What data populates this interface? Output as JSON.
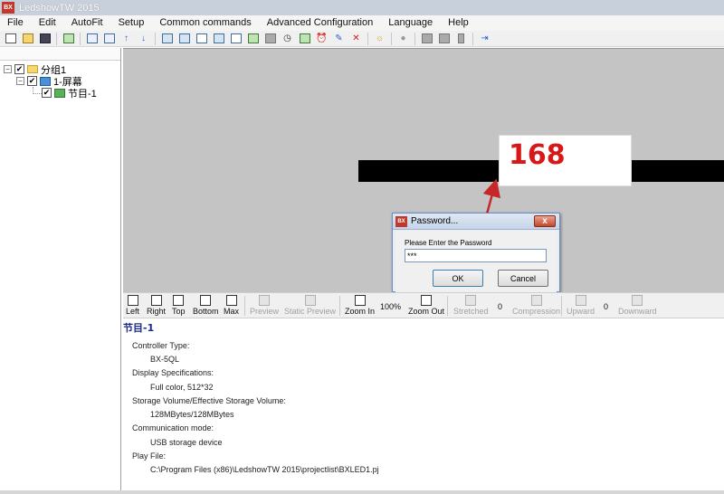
{
  "window": {
    "title": "LedshowTW 2015",
    "app_icon": "BX"
  },
  "menu": [
    "File",
    "Edit",
    "AutoFit",
    "Setup",
    "Common commands",
    "Advanced Configuration",
    "Language",
    "Help"
  ],
  "tree": {
    "group": "分组1",
    "screen": "1-屏幕",
    "program": "节目-1"
  },
  "callout": {
    "text": "168",
    "color": "#d81818"
  },
  "dialog": {
    "icon": "BX",
    "title": "Password...",
    "close": "x",
    "prompt": "Please Enter the Password",
    "value": "***",
    "ok": "OK",
    "cancel": "Cancel"
  },
  "bottom_toolbar": {
    "left": "Left",
    "right": "Right",
    "top": "Top",
    "bottom": "Bottom",
    "max": "Max",
    "preview": "Preview",
    "static_preview": "Static Preview",
    "zoom_in": "Zoom In",
    "zoom_level": "100%",
    "zoom_out": "Zoom Out",
    "stretched": "Stretched",
    "stretched_value": "0",
    "compression": "Compression",
    "upward": "Upward",
    "upward_value": "0",
    "downward": "Downward"
  },
  "info": {
    "title": "节目-1",
    "controller_type_label": "Controller Type:",
    "controller_type": "BX-5QL",
    "display_spec_label": "Display Specifications:",
    "display_spec": "Full color, 512*32",
    "storage_label": "Storage Volume/Effective Storage Volume:",
    "storage": "128MBytes/128MBytes",
    "comm_label": "Communication mode:",
    "comm": "USB storage device",
    "play_file_label": "Play File:",
    "play_file": "C:\\Program Files (x86)\\LedshowTW 2015\\projectlist\\BXLED1.pj"
  }
}
